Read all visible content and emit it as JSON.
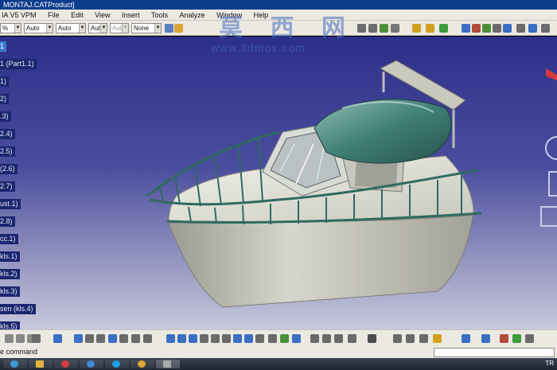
{
  "window": {
    "title": "MONTAJ.CATProduct]"
  },
  "menu": [
    "IA V5 VPM",
    "File",
    "Edit",
    "View",
    "Insert",
    "Tools",
    "Analyze",
    "Window",
    "Help"
  ],
  "toolbar": {
    "zoom_value": "%",
    "combos": [
      "Auto",
      "Auto",
      "Aut",
      "Aut",
      "None"
    ]
  },
  "watermark": {
    "chars": "莫 西 网",
    "url": "www.3dmox.com"
  },
  "tree": {
    "items": [
      "1",
      "1 (Part1.1)",
      "1)",
      "2)",
      ".3)",
      "2.4)",
      "2.5)",
      "(2.6)",
      "2.7)",
      "ust.1)",
      "2.8)",
      "cc.1)",
      "kls.1)",
      "kls.2)",
      "kls.3)",
      "sen (kls.4)",
      "kls.5)"
    ],
    "selected_index": 0
  },
  "command": {
    "label": "e command",
    "value": ""
  },
  "taskbar": {
    "tray_text": "TR"
  }
}
